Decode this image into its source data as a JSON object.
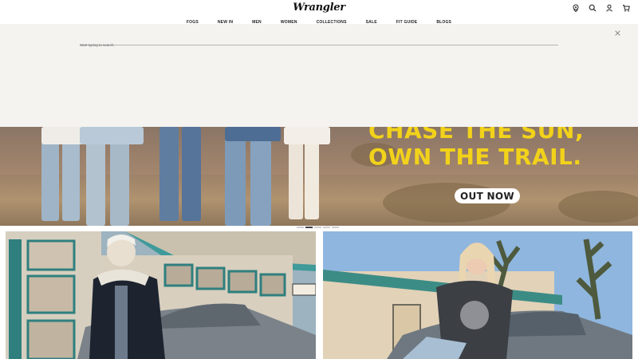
{
  "header": {
    "logo": "Wrangler",
    "nav": [
      "FOGS",
      "NEW IN",
      "MEN",
      "WOMEN",
      "COLLECTIONS",
      "SALE",
      "FIT GUIDE",
      "BLOGS"
    ],
    "icons": [
      "store-locator-icon",
      "search-icon",
      "account-icon",
      "cart-icon"
    ]
  },
  "search": {
    "placeholder": "Start typing to search",
    "value": ""
  },
  "hero": {
    "headline_line1": "CHASE THE SUN,",
    "headline_line2": "OWN THE TRAIL.",
    "cta_label": "OUT NOW",
    "slides_total": 5,
    "active_slide": 2
  },
  "colors": {
    "accent_yellow": "#f2d21a",
    "overlay_bg": "#f4f3f0"
  }
}
